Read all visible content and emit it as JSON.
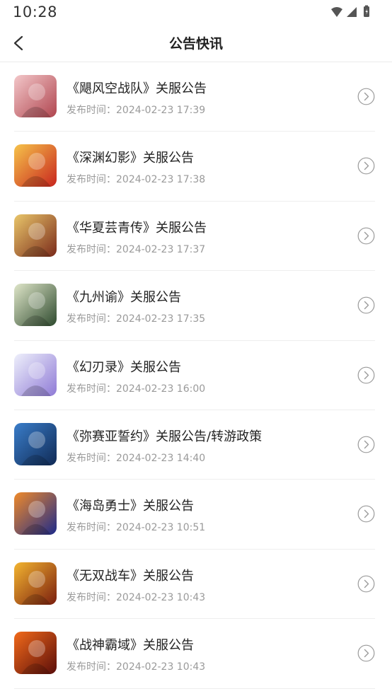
{
  "status_bar": {
    "time": "10:28",
    "icons": [
      "wifi-icon",
      "signal-icon",
      "battery-icon"
    ]
  },
  "header": {
    "title": "公告快讯",
    "back_icon": "chevron-left-icon"
  },
  "time_prefix": "发布时间：",
  "announcements": [
    {
      "title": "《飓风空战队》关服公告",
      "time": "2024-02-23 17:39",
      "colors": [
        "#f3c7c9",
        "#b0454f"
      ]
    },
    {
      "title": "《深渊幻影》关服公告",
      "time": "2024-02-23 17:38",
      "colors": [
        "#f6c34a",
        "#c8251e"
      ]
    },
    {
      "title": "《华夏芸青传》关服公告",
      "time": "2024-02-23 17:37",
      "colors": [
        "#e9c66a",
        "#7a2a1a"
      ]
    },
    {
      "title": "《九州谕》关服公告",
      "time": "2024-02-23 17:35",
      "colors": [
        "#dfe6c9",
        "#2e4a2e"
      ]
    },
    {
      "title": "《幻刃录》关服公告",
      "time": "2024-02-23 16:00",
      "colors": [
        "#eef0fb",
        "#8f7ad6"
      ]
    },
    {
      "title": "《弥赛亚誓约》关服公告/转游政策",
      "time": "2024-02-23 14:40",
      "colors": [
        "#3a7dc9",
        "#102a55"
      ]
    },
    {
      "title": "《海岛勇士》关服公告",
      "time": "2024-02-23 10:51",
      "colors": [
        "#f08a2a",
        "#1d2a8a"
      ]
    },
    {
      "title": "《无双战车》关服公告",
      "time": "2024-02-23 10:43",
      "colors": [
        "#f3b530",
        "#7a1d0e"
      ]
    },
    {
      "title": "《战神霸域》关服公告",
      "time": "2024-02-23 10:43",
      "colors": [
        "#f26a1a",
        "#5a0d0a"
      ]
    }
  ],
  "colors": {
    "title_text": "#222222",
    "time_text": "#9a9a9a",
    "divider": "#eeeeee",
    "arrow": "#9a9a9a"
  }
}
